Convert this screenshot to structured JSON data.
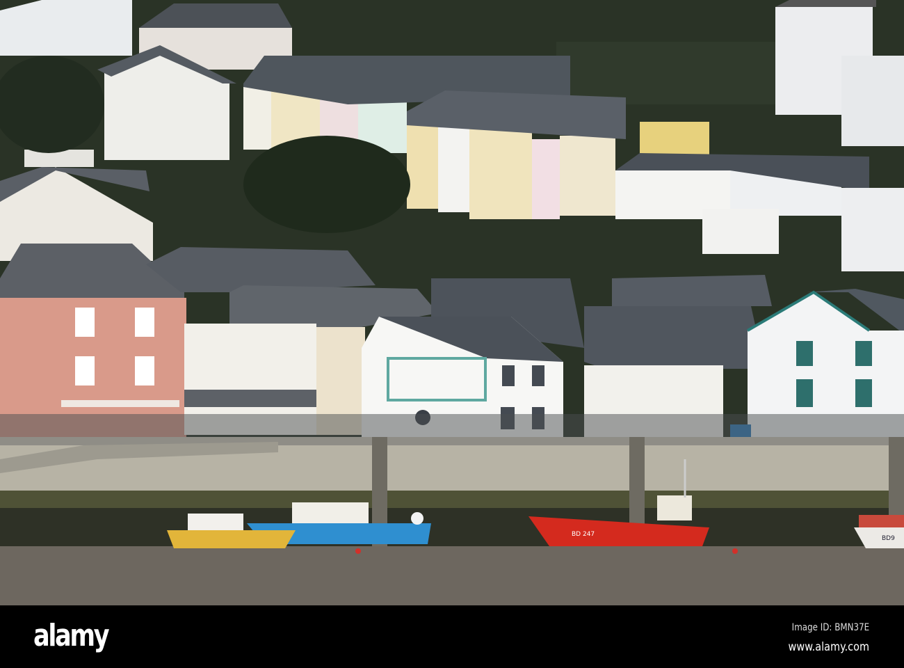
{
  "watermark": {
    "logo": "alamy",
    "image_id": "Image ID: BMN37E",
    "url": "www.alamy.com"
  },
  "boats": {
    "red_boat_reg": "BD 247",
    "right_boat_reg": "BD9"
  },
  "colors": {
    "hillside": "#2a3326",
    "pink_building": "#d99a8a",
    "quay_wall": "#b7b3a5",
    "water": "#6d675f",
    "red_boat": "#d42a1e",
    "blue_boat": "#2f8fd0",
    "yellow_boat": "#e2b53a"
  }
}
